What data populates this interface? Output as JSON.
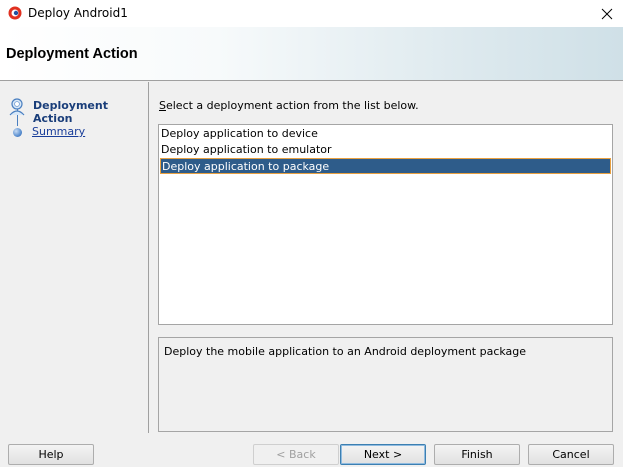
{
  "window": {
    "title": "Deploy Android1",
    "icon": "app-logo-icon"
  },
  "header": {
    "title": "Deployment Action"
  },
  "nav": {
    "items": [
      {
        "label": "Deployment Action",
        "state": "active",
        "icon": "user-step-icon"
      },
      {
        "label": "Summary",
        "state": "link",
        "icon": "step-dot-icon"
      }
    ]
  },
  "main": {
    "prompt": "Select a deployment action from the list below.",
    "prompt_mnemonic": "S",
    "actions": [
      {
        "label": "Deploy application to device",
        "selected": false
      },
      {
        "label": "Deploy application to emulator",
        "selected": false
      },
      {
        "label": "Deploy application to package",
        "selected": true
      }
    ],
    "description": "Deploy the mobile application to an Android deployment package"
  },
  "buttons": {
    "help": "Help",
    "back": "< Back",
    "next": "Next >",
    "finish": "Finish",
    "cancel": "Cancel"
  },
  "colors": {
    "selection": "#2e5c8a",
    "selection_border": "#e8a040",
    "link": "#1a3e9a"
  }
}
